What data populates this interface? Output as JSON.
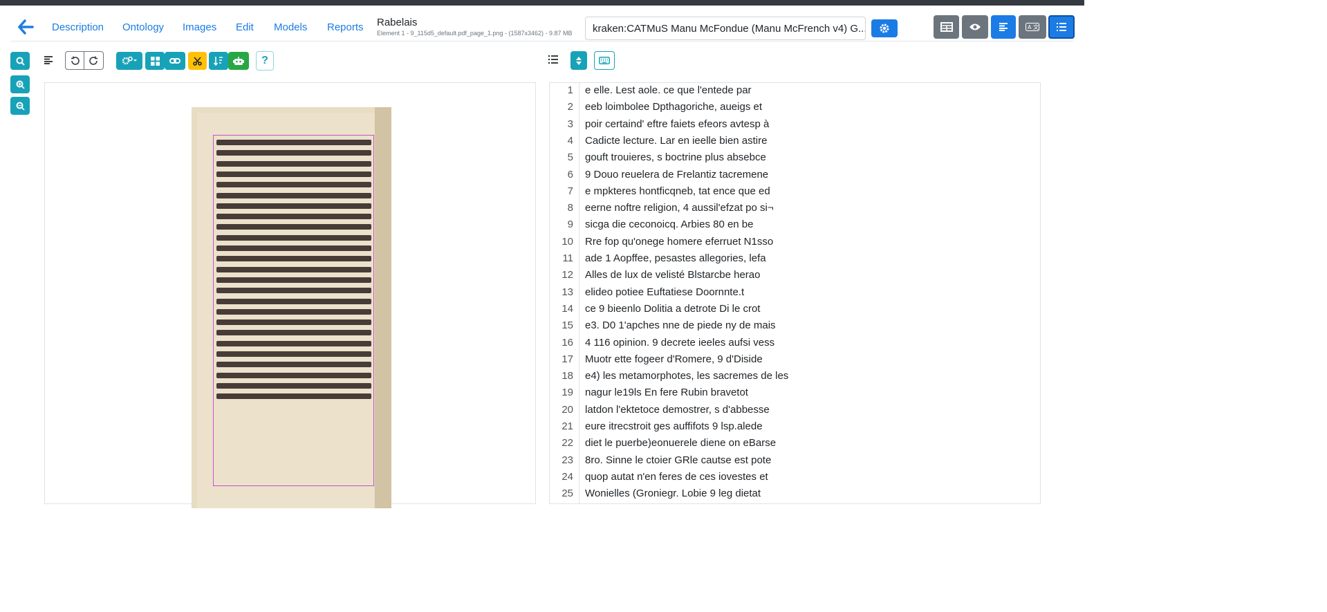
{
  "nav": {
    "links": [
      "Description",
      "Ontology",
      "Images",
      "Edit",
      "Models",
      "Reports"
    ]
  },
  "document": {
    "title": "Rabelais",
    "subtitle": "Element 1 - 9_115d5_default.pdf_page_1.png - (1587x3462) - 9.87 MB"
  },
  "model": {
    "selected": "kraken:CATMuS Manu McFondue (Manu McFrench v4) G..."
  },
  "icons": {
    "back": "arrow-left-icon",
    "settings": "gear-icon",
    "search": "search-icon",
    "zoom_in": "zoom-in-icon",
    "zoom_out": "zoom-out-icon",
    "help": "question-icon",
    "keyboard": "keyboard-icon"
  },
  "colors": {
    "primary": "#1b7ce5",
    "teal": "#17a2b8",
    "warning": "#ffc107",
    "success": "#28a745",
    "secondary": "#6c757d",
    "topbar": "#343a40"
  },
  "toolbar": {
    "help_label": "?"
  },
  "transcription": {
    "lines": [
      {
        "n": "1",
        "text": "e elle. Lest aole. ce que l'entede par"
      },
      {
        "n": "2",
        "text": "eeb loimbolee Dpthagoriche, aueigs et"
      },
      {
        "n": "3",
        "text": "poir certaind' eftre faiets efeors avtesp à"
      },
      {
        "n": "4",
        "text": "Cadicte lecture. Lar en ieelle bien astire"
      },
      {
        "n": "5",
        "text": "gouft trouieres, s boctrine plus absebce"
      },
      {
        "n": "6",
        "text": "9 Douo reuelera de Frelantiz tacremene"
      },
      {
        "n": "7",
        "text": "e mpkteres hontficqneb, tat ence que ed"
      },
      {
        "n": "8",
        "text": "eerne noftre religion, 4 aussil'efzat po si¬"
      },
      {
        "n": "9",
        "text": "sicga die ceconoicq. Arbies 80 en be"
      },
      {
        "n": "10",
        "text": "Rre fop qu'onege homere eferruet N1sso"
      },
      {
        "n": "11",
        "text": "ade 1 Aopffee, pesastes allegories, lefa"
      },
      {
        "n": "12",
        "text": "Alles de lux de velisté Blstarcbe herao"
      },
      {
        "n": "13",
        "text": "elideo potiee Euftatiese Doornnte.t"
      },
      {
        "n": "14",
        "text": "ce 9 bieenlo Dolitia a detrote Di le crot"
      },
      {
        "n": "15",
        "text": "e3. D0 1'apches nne de piede ny de mais"
      },
      {
        "n": "16",
        "text": "4 116 opinion. 9 decrete ieeles aufsi vess"
      },
      {
        "n": "17",
        "text": "Muotr ette fogeer d'Romere, 9 d'Diside"
      },
      {
        "n": "18",
        "text": "e4) les metamorphotes, les sacremes de les"
      },
      {
        "n": "19",
        "text": "nagur le19ls En fere Rubin bravetot"
      },
      {
        "n": "20",
        "text": "latdon l'ektetoce demostrer, s d'abbesse"
      },
      {
        "n": "21",
        "text": "eure itrecstroit ges auffifots 9 lsp.alede"
      },
      {
        "n": "22",
        "text": "diet le puerbe)eonuerele diene on eBarse"
      },
      {
        "n": "23",
        "text": "8ro. Sinne le ctoier GRle cautse est pote"
      },
      {
        "n": "24",
        "text": "quop autat n'en feres de ces iovestes et"
      },
      {
        "n": "25",
        "text": "Wonielles (Groniegr. Lobie 9 leg dietat"
      }
    ]
  }
}
